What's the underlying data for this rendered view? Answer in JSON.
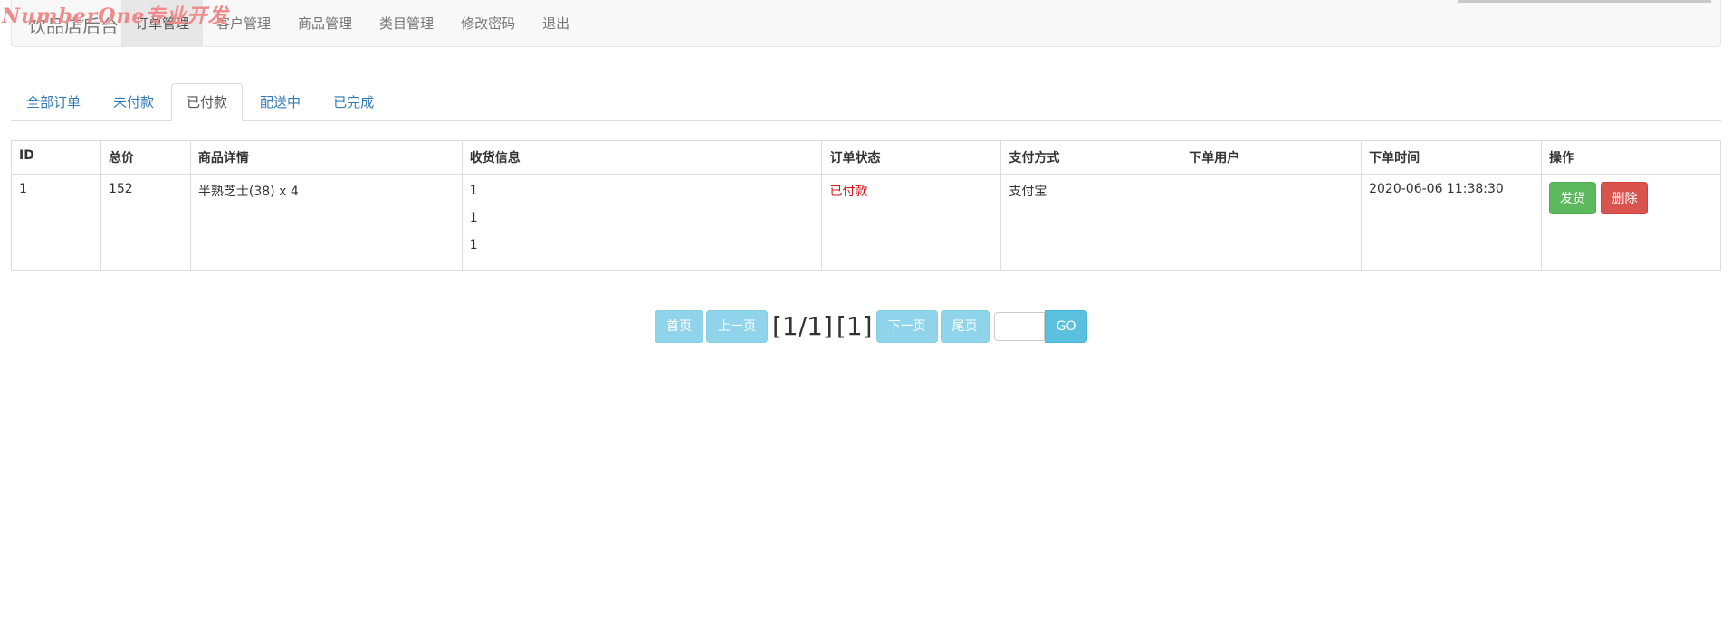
{
  "watermark": "NumberOne专业开发",
  "navbar": {
    "brand": "饮品店后台",
    "items": [
      {
        "label": "订单管理",
        "active": true
      },
      {
        "label": "客户管理",
        "active": false
      },
      {
        "label": "商品管理",
        "active": false
      },
      {
        "label": "类目管理",
        "active": false
      },
      {
        "label": "修改密码",
        "active": false
      },
      {
        "label": "退出",
        "active": false
      }
    ]
  },
  "tabs": [
    {
      "label": "全部订单",
      "active": false
    },
    {
      "label": "未付款",
      "active": false
    },
    {
      "label": "已付款",
      "active": true
    },
    {
      "label": "配送中",
      "active": false
    },
    {
      "label": "已完成",
      "active": false
    }
  ],
  "table": {
    "headers": [
      "ID",
      "总价",
      "商品详情",
      "收货信息",
      "订单状态",
      "支付方式",
      "下单用户",
      "下单时间",
      "操作"
    ],
    "rows": [
      {
        "id": "1",
        "total": "152",
        "detail": "半熟芝士(38) x 4",
        "address_lines": [
          "1",
          "1",
          "1"
        ],
        "status": "已付款",
        "payment": "支付宝",
        "user": "",
        "time": "2020-06-06 11:38:30",
        "actions": {
          "ship": "发货",
          "delete": "删除"
        }
      }
    ]
  },
  "pager": {
    "first": "首页",
    "prev": "上一页",
    "page_info": "[1/1]",
    "total": "[1]",
    "next": "下一页",
    "last": "尾页",
    "input_value": "",
    "go": "GO"
  },
  "colors": {
    "status_paid": "#cc1a1a",
    "ship_button": "#5cb85c",
    "delete_button": "#d9534f",
    "pager_button": "#8fd4ea",
    "go_button": "#5bc0de",
    "link": "#337ab7"
  }
}
